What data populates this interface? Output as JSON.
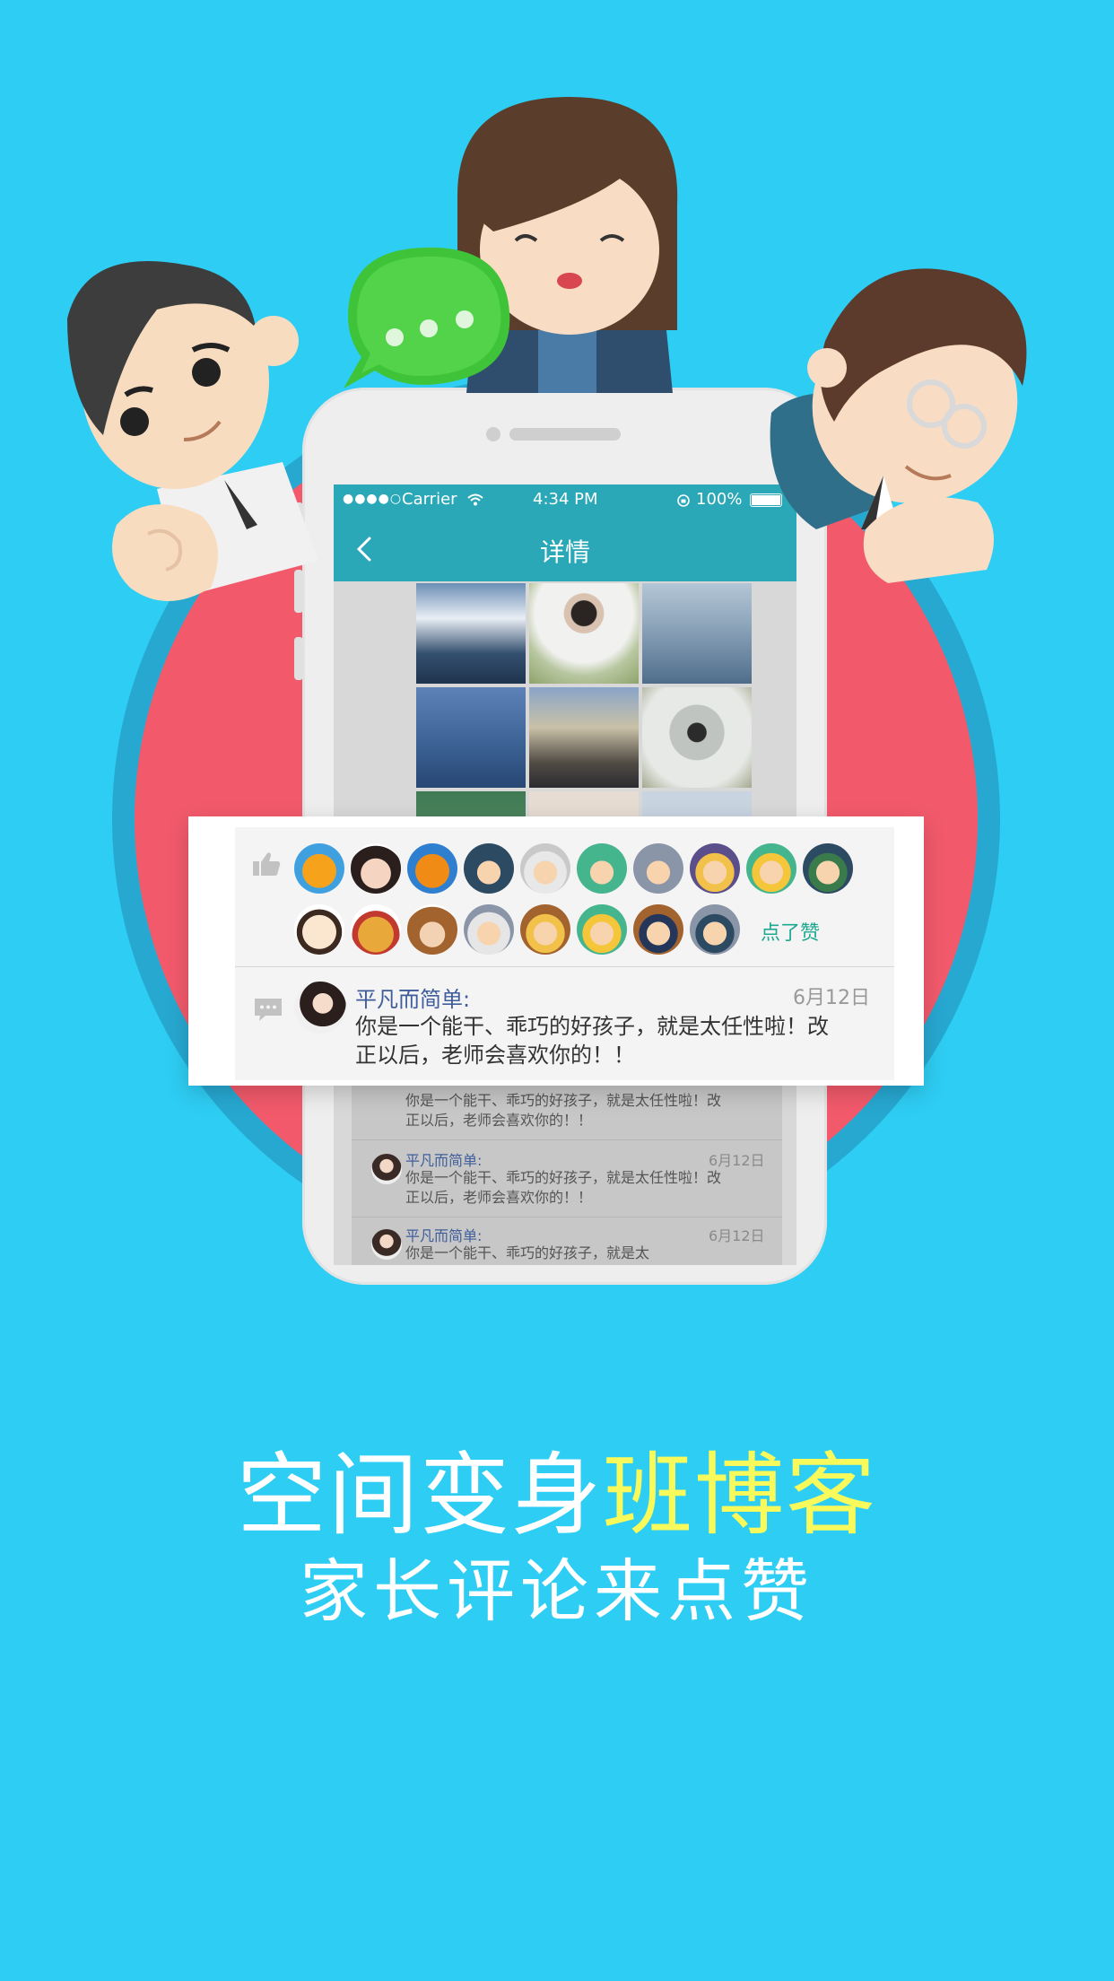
{
  "status_bar": {
    "carrier": "Carrier",
    "time": "4:34 PM",
    "battery": "100%"
  },
  "nav": {
    "title": "详情"
  },
  "likes": {
    "label": "点了赞"
  },
  "comment": {
    "name": "平凡而简单:",
    "date": "6月12日",
    "text_line1": "你是一个能干、乖巧的好孩子，就是太任性啦！改",
    "text_line2": "正以后，老师会喜欢你的！！"
  },
  "bg_comment": {
    "name": "平凡而简单:",
    "date": "6月12日",
    "line1": "你是一个能干、乖巧的好孩子，就是太任性啦！改",
    "line2": "正以后，老师会喜欢你的！！",
    "partial_line": "你是一个能干、乖巧的好孩子，就是太任性啦！改",
    "partial_line2": "正以后，老师会喜欢你的！！",
    "cut_line": "你是一个能干、乖巧的好孩子，就是太"
  },
  "slogan": {
    "main_white": "空间变身",
    "main_yellow": "班博客",
    "sub": "家长评论来点赞"
  },
  "colors": {
    "background": "#2ecdf3",
    "circle": "#f25a6c",
    "accent": "#2aa8b7",
    "highlight": "#f8f95a",
    "like_green": "#1da891"
  }
}
